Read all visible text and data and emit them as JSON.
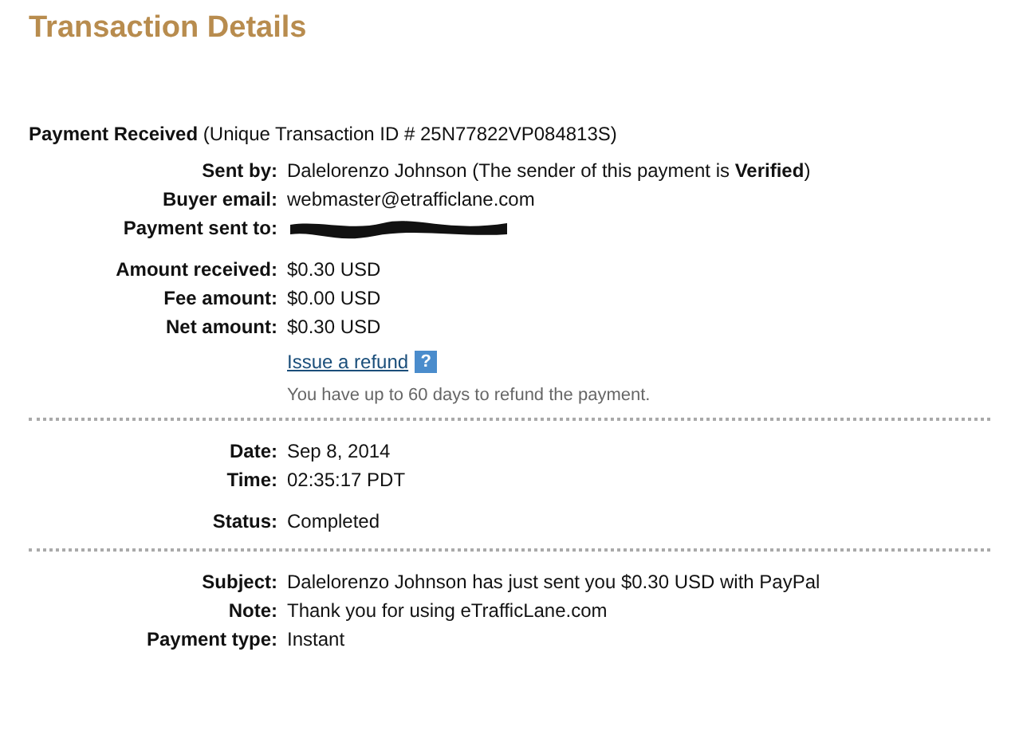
{
  "title": "Transaction Details",
  "header": {
    "label": "Payment Received",
    "detail": "(Unique Transaction ID # 25N77822VP084813S)"
  },
  "sections": [
    {
      "groups": [
        [
          {
            "label": "Sent by:",
            "value": "Dalelorenzo Johnson (The sender of this payment is **Verified**)",
            "kind": "text"
          },
          {
            "label": "Buyer email:",
            "value": "webmaster@etrafficlane.com",
            "kind": "text"
          },
          {
            "label": "Payment sent to:",
            "kind": "redacted"
          }
        ],
        [
          {
            "label": "Amount received:",
            "value": "$0.30 USD",
            "kind": "text"
          },
          {
            "label": "Fee amount:",
            "value": "$0.00 USD",
            "kind": "text"
          },
          {
            "label": "Net amount:",
            "value": "$0.30 USD",
            "kind": "text"
          }
        ]
      ],
      "refund": {
        "link": "Issue a refund",
        "help": "?",
        "note": "You have up to 60 days to refund the payment."
      }
    },
    {
      "groups": [
        [
          {
            "label": "Date:",
            "value": "Sep 8, 2014",
            "kind": "text"
          },
          {
            "label": "Time:",
            "value": "02:35:17 PDT",
            "kind": "text"
          }
        ],
        [
          {
            "label": "Status:",
            "value": "Completed",
            "kind": "text"
          }
        ]
      ]
    },
    {
      "groups": [
        [
          {
            "label": "Subject:",
            "value": "Dalelorenzo Johnson has just sent you $0.30 USD with PayPal",
            "kind": "text"
          },
          {
            "label": "Note:",
            "value": "Thank you for using eTrafficLane.com",
            "kind": "text"
          },
          {
            "label": "Payment type:",
            "value": "Instant",
            "kind": "text"
          }
        ]
      ]
    }
  ]
}
